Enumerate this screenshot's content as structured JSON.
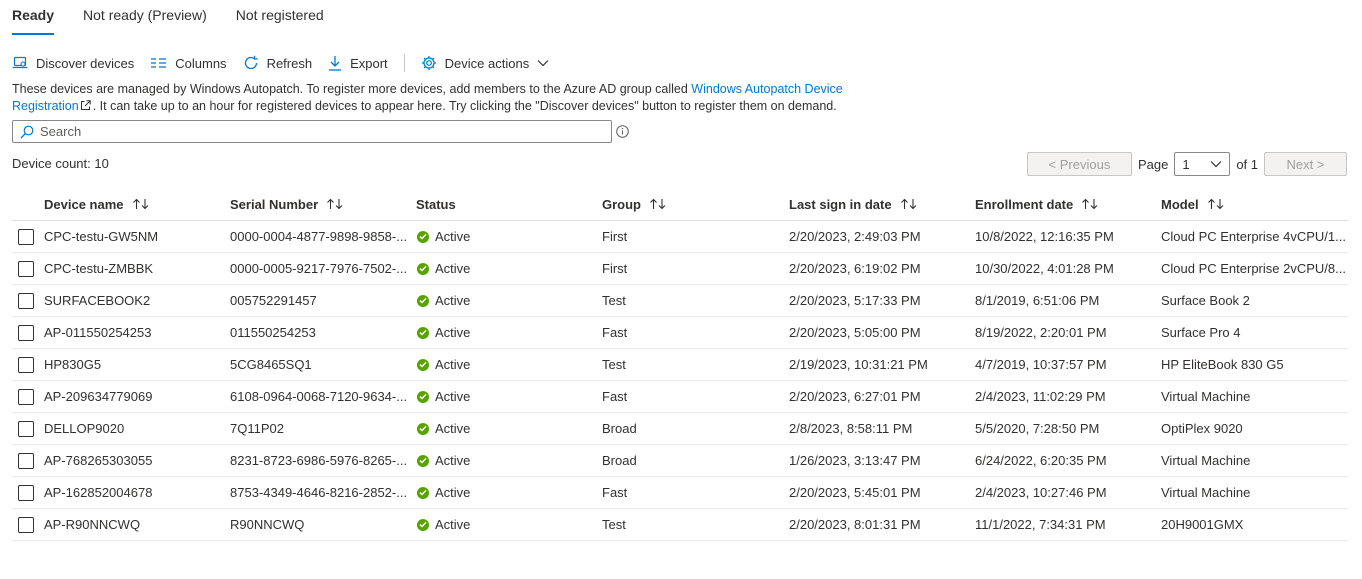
{
  "tabs": [
    {
      "label": "Ready",
      "active": true
    },
    {
      "label": "Not ready (Preview)",
      "active": false
    },
    {
      "label": "Not registered",
      "active": false
    }
  ],
  "toolbar": {
    "discover": "Discover devices",
    "columns": "Columns",
    "refresh": "Refresh",
    "export": "Export",
    "device_actions": "Device actions"
  },
  "info": {
    "text_before": "These devices are managed by Windows Autopatch. To register more devices, add members to the Azure AD group called ",
    "link": "Windows Autopatch Device Registration",
    "text_after": ". It can take up to an hour for registered devices to appear here. Try clicking the \"Discover devices\" button to register them on demand."
  },
  "search": {
    "placeholder": "Search",
    "value": ""
  },
  "device_count": "Device count: 10",
  "pager": {
    "previous": "< Previous",
    "page_label": "Page",
    "page_value": "1",
    "of_label": "of 1",
    "next": "Next >"
  },
  "columns": {
    "name": "Device name",
    "serial": "Serial Number",
    "status": "Status",
    "group": "Group",
    "last_sign_in": "Last sign in date",
    "enrollment": "Enrollment date",
    "model": "Model"
  },
  "status_color": "#57a300",
  "accent_color": "#0078d4",
  "rows": [
    {
      "name": "CPC-testu-GW5NM",
      "serial": "0000-0004-4877-9898-9858-...",
      "status": "Active",
      "group": "First",
      "last_sign_in": "2/20/2023, 2:49:03 PM",
      "enrollment": "10/8/2022, 12:16:35 PM",
      "model": "Cloud PC Enterprise 4vCPU/1..."
    },
    {
      "name": "CPC-testu-ZMBBK",
      "serial": "0000-0005-9217-7976-7502-...",
      "status": "Active",
      "group": "First",
      "last_sign_in": "2/20/2023, 6:19:02 PM",
      "enrollment": "10/30/2022, 4:01:28 PM",
      "model": "Cloud PC Enterprise 2vCPU/8..."
    },
    {
      "name": "SURFACEBOOK2",
      "serial": "005752291457",
      "status": "Active",
      "group": "Test",
      "last_sign_in": "2/20/2023, 5:17:33 PM",
      "enrollment": "8/1/2019, 6:51:06 PM",
      "model": "Surface Book 2"
    },
    {
      "name": "AP-011550254253",
      "serial": "011550254253",
      "status": "Active",
      "group": "Fast",
      "last_sign_in": "2/20/2023, 5:05:00 PM",
      "enrollment": "8/19/2022, 2:20:01 PM",
      "model": "Surface Pro 4"
    },
    {
      "name": "HP830G5",
      "serial": "5CG8465SQ1",
      "status": "Active",
      "group": "Test",
      "last_sign_in": "2/19/2023, 10:31:21 PM",
      "enrollment": "4/7/2019, 10:37:57 PM",
      "model": "HP EliteBook 830 G5"
    },
    {
      "name": "AP-209634779069",
      "serial": "6108-0964-0068-7120-9634-...",
      "status": "Active",
      "group": "Fast",
      "last_sign_in": "2/20/2023, 6:27:01 PM",
      "enrollment": "2/4/2023, 11:02:29 PM",
      "model": "Virtual Machine"
    },
    {
      "name": "DELLOP9020",
      "serial": "7Q11P02",
      "status": "Active",
      "group": "Broad",
      "last_sign_in": "2/8/2023, 8:58:11 PM",
      "enrollment": "5/5/2020, 7:28:50 PM",
      "model": "OptiPlex 9020"
    },
    {
      "name": "AP-768265303055",
      "serial": "8231-8723-6986-5976-8265-...",
      "status": "Active",
      "group": "Broad",
      "last_sign_in": "1/26/2023, 3:13:47 PM",
      "enrollment": "6/24/2022, 6:20:35 PM",
      "model": "Virtual Machine"
    },
    {
      "name": "AP-162852004678",
      "serial": "8753-4349-4646-8216-2852-...",
      "status": "Active",
      "group": "Fast",
      "last_sign_in": "2/20/2023, 5:45:01 PM",
      "enrollment": "2/4/2023, 10:27:46 PM",
      "model": "Virtual Machine"
    },
    {
      "name": "AP-R90NNCWQ",
      "serial": "R90NNCWQ",
      "status": "Active",
      "group": "Test",
      "last_sign_in": "2/20/2023, 8:01:31 PM",
      "enrollment": "11/1/2022, 7:34:31 PM",
      "model": "20H9001GMX"
    }
  ]
}
